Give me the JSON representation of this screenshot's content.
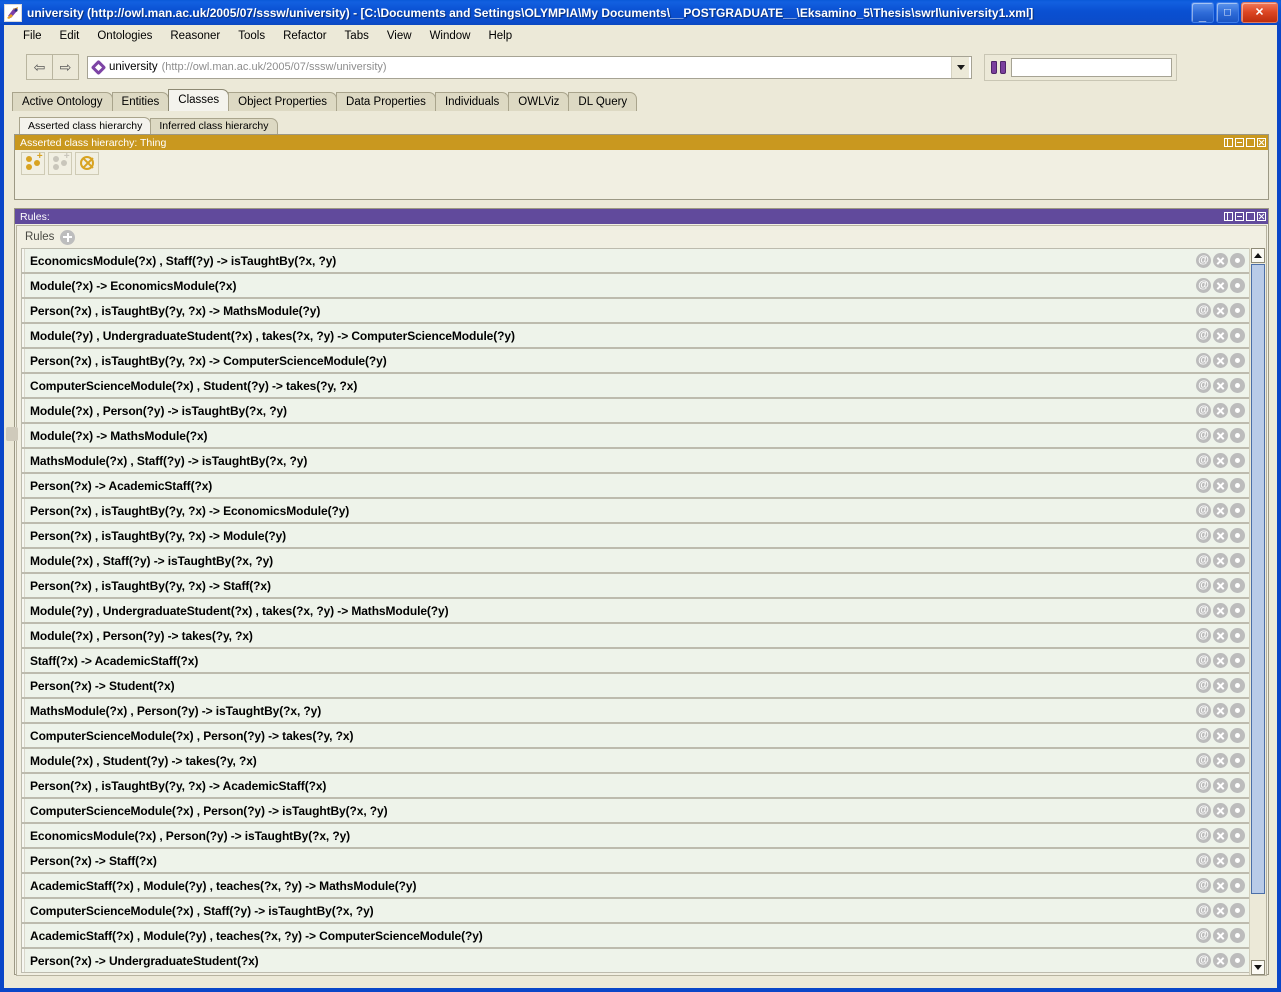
{
  "window": {
    "title": "university (http://owl.man.ac.uk/2005/07/sssw/university) - [C:\\Documents and Settings\\OLYMPIA\\My Documents\\__POSTGRADUATE__\\Eksamino_5\\Thesis\\swrl\\university1.xml]",
    "app_icon": "protege-icon",
    "minimize_label": "_",
    "maximize_label": "□",
    "close_label": "✕",
    "titlebar_color": "#0a50d2",
    "frame_color": "#0a46c8"
  },
  "menu": {
    "items": [
      {
        "label": "File"
      },
      {
        "label": "Edit"
      },
      {
        "label": "Ontologies"
      },
      {
        "label": "Reasoner"
      },
      {
        "label": "Tools"
      },
      {
        "label": "Refactor"
      },
      {
        "label": "Tabs"
      },
      {
        "label": "View"
      },
      {
        "label": "Window"
      },
      {
        "label": "Help"
      }
    ]
  },
  "toolbar": {
    "back_icon": "arrow-left-icon",
    "back_glyph": "⇦",
    "forward_icon": "arrow-right-icon",
    "forward_glyph": "⇨",
    "ontology_icon": "ontology-diamond-icon",
    "ontology_name": "university",
    "ontology_uri": "(http://owl.man.ac.uk/2005/07/sssw/university)",
    "dropdown_icon": "chevron-down-icon",
    "search_icon": "binoculars-icon",
    "search_value": "",
    "search_placeholder": ""
  },
  "tabs": {
    "items": [
      {
        "label": "Active Ontology",
        "selected": false
      },
      {
        "label": "Entities",
        "selected": false
      },
      {
        "label": "Classes",
        "selected": true
      },
      {
        "label": "Object Properties",
        "selected": false
      },
      {
        "label": "Data Properties",
        "selected": false
      },
      {
        "label": "Individuals",
        "selected": false
      },
      {
        "label": "OWLViz",
        "selected": false
      },
      {
        "label": "DL Query",
        "selected": false
      }
    ]
  },
  "class_hierarchy": {
    "tabs": [
      {
        "label": "Asserted class hierarchy",
        "selected": true
      },
      {
        "label": "Inferred class hierarchy",
        "selected": false
      }
    ],
    "caption": "Asserted class hierarchy: Thing",
    "caption_color": "#c9981f",
    "toolbar": [
      {
        "name": "add-subclass-button",
        "icon": "add-subclass-icon",
        "enabled": true
      },
      {
        "name": "add-sibling-class-button",
        "icon": "add-sibling-class-icon",
        "enabled": false
      },
      {
        "name": "delete-class-button",
        "icon": "delete-class-icon",
        "enabled": true
      }
    ],
    "window_buttons": [
      {
        "name": "split-panel-button",
        "icon": "split-panel-icon"
      },
      {
        "name": "minimize-panel-button",
        "icon": "minimize-panel-icon"
      },
      {
        "name": "maximize-panel-button",
        "icon": "maximize-panel-icon"
      },
      {
        "name": "close-panel-button",
        "icon": "close-panel-icon"
      }
    ]
  },
  "rules_panel": {
    "caption": "Rules:",
    "caption_color": "#614a9c",
    "list_label": "Rules",
    "add_button_icon": "plus-circle-icon",
    "row_actions": [
      {
        "name": "rule-annotation-button",
        "icon": "at-sign-icon",
        "glyph": "@"
      },
      {
        "name": "rule-delete-button",
        "icon": "close-circle-icon",
        "glyph": ""
      },
      {
        "name": "rule-toggle-button",
        "icon": "dot-circle-icon",
        "glyph": ""
      }
    ],
    "scrollbar": {
      "up_icon": "scroll-up-arrow-icon",
      "down_icon": "scroll-down-arrow-icon"
    },
    "rules": [
      "EconomicsModule(?x) , Staff(?y) -> isTaughtBy(?x, ?y)",
      "Module(?x) -> EconomicsModule(?x)",
      "Person(?x) , isTaughtBy(?y, ?x) -> MathsModule(?y)",
      "Module(?y) , UndergraduateStudent(?x) , takes(?x, ?y) -> ComputerScienceModule(?y)",
      "Person(?x) , isTaughtBy(?y, ?x) -> ComputerScienceModule(?y)",
      "ComputerScienceModule(?x) , Student(?y) -> takes(?y, ?x)",
      "Module(?x) , Person(?y) -> isTaughtBy(?x, ?y)",
      "Module(?x) -> MathsModule(?x)",
      "MathsModule(?x) , Staff(?y) -> isTaughtBy(?x, ?y)",
      "Person(?x) -> AcademicStaff(?x)",
      "Person(?x) , isTaughtBy(?y, ?x) -> EconomicsModule(?y)",
      "Person(?x) , isTaughtBy(?y, ?x) -> Module(?y)",
      "Module(?x) , Staff(?y) -> isTaughtBy(?x, ?y)",
      "Person(?x) , isTaughtBy(?y, ?x) -> Staff(?x)",
      "Module(?y) , UndergraduateStudent(?x) , takes(?x, ?y) -> MathsModule(?y)",
      "Module(?x) , Person(?y) -> takes(?y, ?x)",
      "Staff(?x) -> AcademicStaff(?x)",
      "Person(?x) -> Student(?x)",
      "MathsModule(?x) , Person(?y) -> isTaughtBy(?x, ?y)",
      "ComputerScienceModule(?x) , Person(?y) -> takes(?y, ?x)",
      "Module(?x) , Student(?y) -> takes(?y, ?x)",
      "Person(?x) , isTaughtBy(?y, ?x) -> AcademicStaff(?x)",
      "ComputerScienceModule(?x) , Person(?y) -> isTaughtBy(?x, ?y)",
      "EconomicsModule(?x) , Person(?y) -> isTaughtBy(?x, ?y)",
      "Person(?x) -> Staff(?x)",
      "AcademicStaff(?x) , Module(?y) , teaches(?x, ?y) -> MathsModule(?y)",
      "ComputerScienceModule(?x) , Staff(?y) -> isTaughtBy(?x, ?y)",
      "AcademicStaff(?x) , Module(?y) , teaches(?x, ?y) -> ComputerScienceModule(?y)",
      "Person(?x) -> UndergraduateStudent(?x)"
    ]
  }
}
